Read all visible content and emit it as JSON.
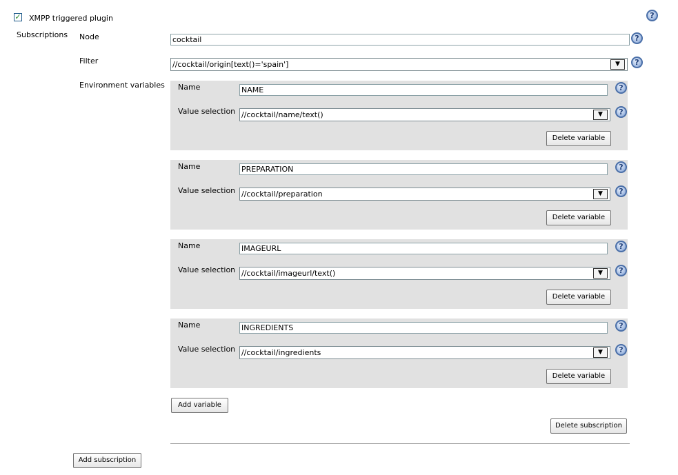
{
  "plugin": {
    "enabled": true,
    "label": "XMPP triggered plugin"
  },
  "labels": {
    "subscriptions": "Subscriptions",
    "node": "Node",
    "filter": "Filter",
    "environment_variables": "Environment variables",
    "name": "Name",
    "value_selection": "Value selection"
  },
  "subscription": {
    "node": "cocktail",
    "filter": "//cocktail/origin[text()='spain']"
  },
  "variables": [
    {
      "name": "NAME",
      "value": "//cocktail/name/text()"
    },
    {
      "name": "PREPARATION",
      "value": "//cocktail/preparation"
    },
    {
      "name": "IMAGEURL",
      "value": "//cocktail/imageurl/text()"
    },
    {
      "name": "INGREDIENTS",
      "value": "//cocktail/ingredients"
    }
  ],
  "buttons": {
    "delete_variable": "Delete variable",
    "add_variable": "Add variable",
    "delete_subscription": "Delete subscription",
    "add_subscription": "Add subscription"
  },
  "icons": {
    "help": "help-icon",
    "dropdown": "dropdown-arrow-icon",
    "check": "checkmark-icon"
  }
}
